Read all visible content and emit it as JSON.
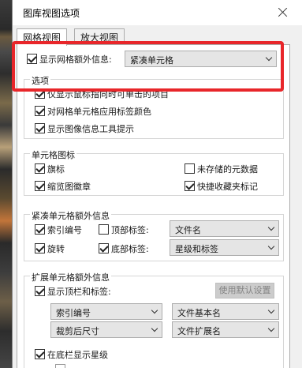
{
  "window": {
    "title": "图库视图选项"
  },
  "tabs": [
    {
      "label": "网格视图"
    },
    {
      "label": "放大视图"
    }
  ],
  "grid_extras": {
    "checkbox_label": "显示网格额外信息:",
    "checked": true,
    "style_value": "紧凑单元格"
  },
  "options": {
    "title": "选项",
    "items": [
      {
        "label": "仅显示鼠标指向时可单击的项目",
        "checked": true
      },
      {
        "label": "对网格单元格应用标签颜色",
        "checked": true
      },
      {
        "label": "显示图像信息工具提示",
        "checked": true
      }
    ]
  },
  "cell_icons": {
    "title": "单元格图标",
    "flags": {
      "label": "旗标",
      "checked": true
    },
    "thumbnail_badges": {
      "label": "缩览图徽章",
      "checked": true
    },
    "unsaved_metadata": {
      "label": "未存储的元数据",
      "checked": false
    },
    "quick_collection": {
      "label": "快捷收藏夹标记",
      "checked": true
    }
  },
  "compact_extras": {
    "title": "紧凑单元格额外信息",
    "index_number": {
      "label": "索引编号",
      "checked": true
    },
    "top_label": {
      "label": "顶部标签:",
      "checked": false,
      "value": "文件名"
    },
    "rotation": {
      "label": "旋转",
      "checked": true
    },
    "bottom_label": {
      "label": "底部标签:",
      "checked": true,
      "value": "星级和标签"
    }
  },
  "expanded_extras": {
    "title": "扩展单元格额外信息",
    "header": {
      "label": "显示顶栏和标签:",
      "checked": true
    },
    "default_button": "使用默认设置",
    "selects": [
      "索引编号",
      "文件基本名",
      "裁剪后尺寸",
      "文件扩展名"
    ],
    "footer": {
      "label": "在底栏显示星级",
      "checked": true
    }
  }
}
